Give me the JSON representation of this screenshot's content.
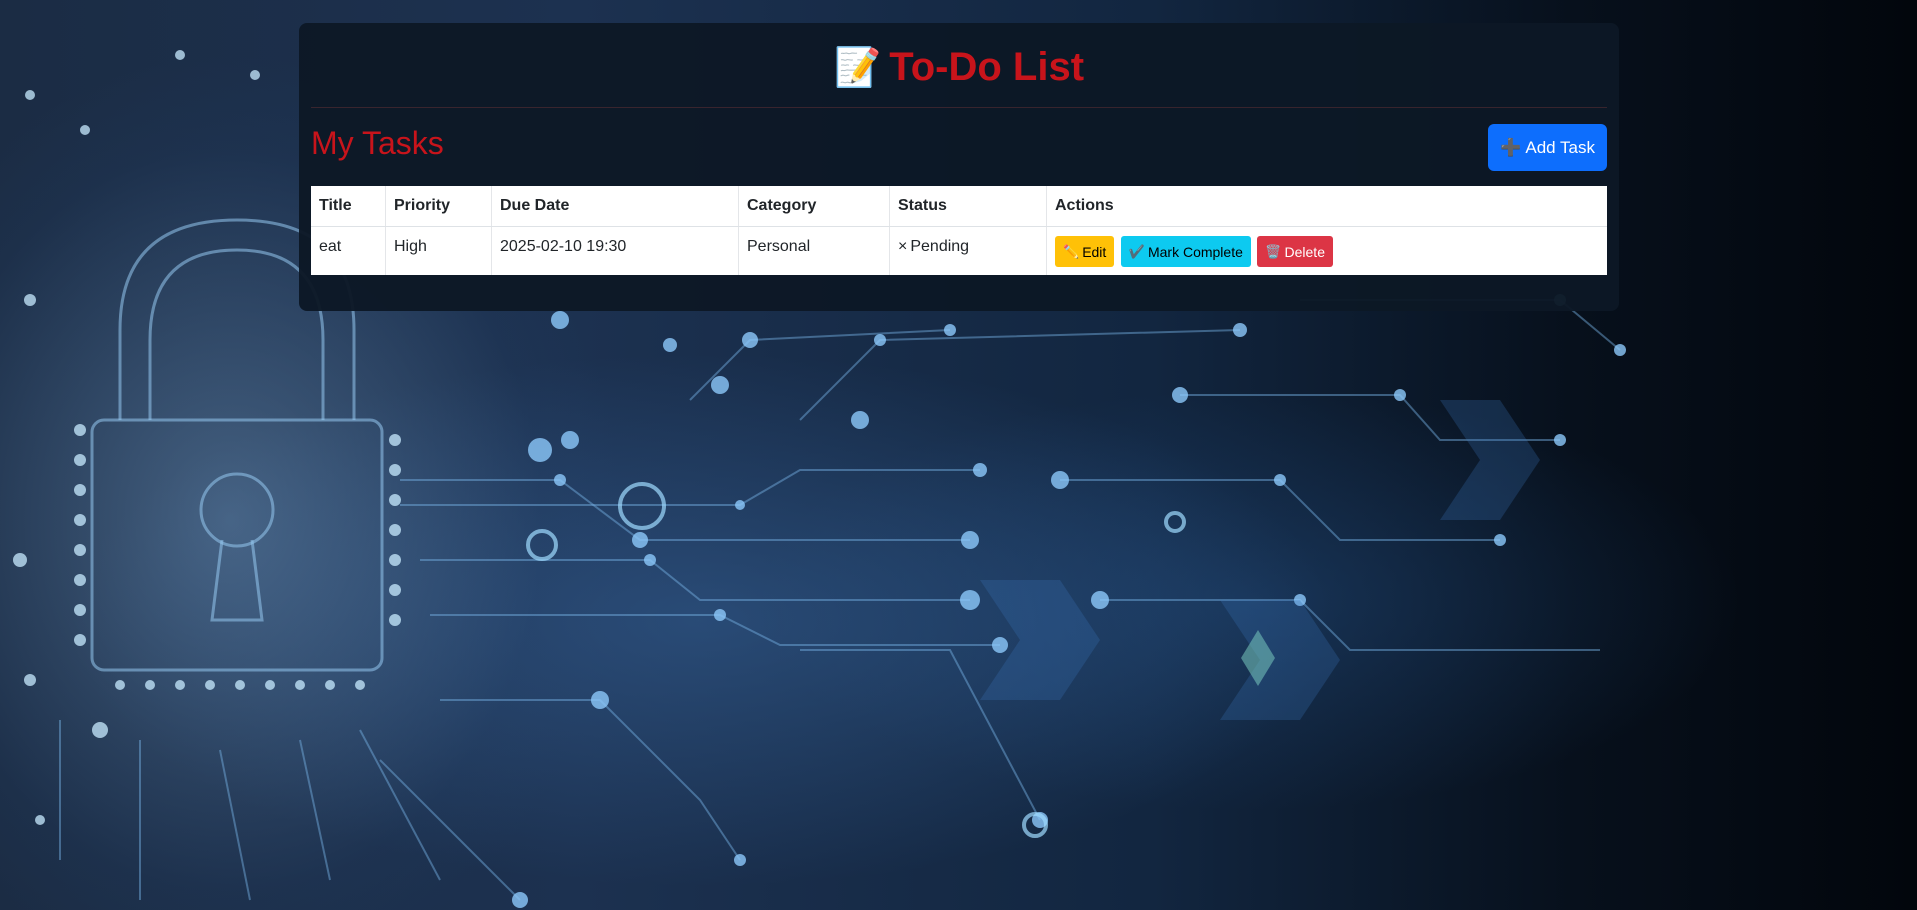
{
  "app": {
    "title": "To-Do List",
    "title_icon": "memo-icon",
    "accent_color": "#c8141b"
  },
  "tasks_section": {
    "heading": "My Tasks",
    "add_button_label": "Add Task",
    "add_button_icon": "plus-icon",
    "add_button_color": "#0d6efd"
  },
  "table": {
    "columns": [
      "Title",
      "Priority",
      "Due Date",
      "Category",
      "Status",
      "Actions"
    ],
    "rows": [
      {
        "title": "eat",
        "priority": "High",
        "due_date": "2025-02-10 19:30",
        "category": "Personal",
        "status": "Pending",
        "status_icon": "x-icon",
        "actions": {
          "edit_label": "Edit",
          "edit_icon": "pencil-icon",
          "edit_color": "#ffc107",
          "complete_label": "Mark Complete",
          "complete_icon": "check-icon",
          "complete_color": "#0dcaf0",
          "delete_label": "Delete",
          "delete_icon": "trash-icon",
          "delete_color": "#dc3545"
        }
      }
    ]
  }
}
